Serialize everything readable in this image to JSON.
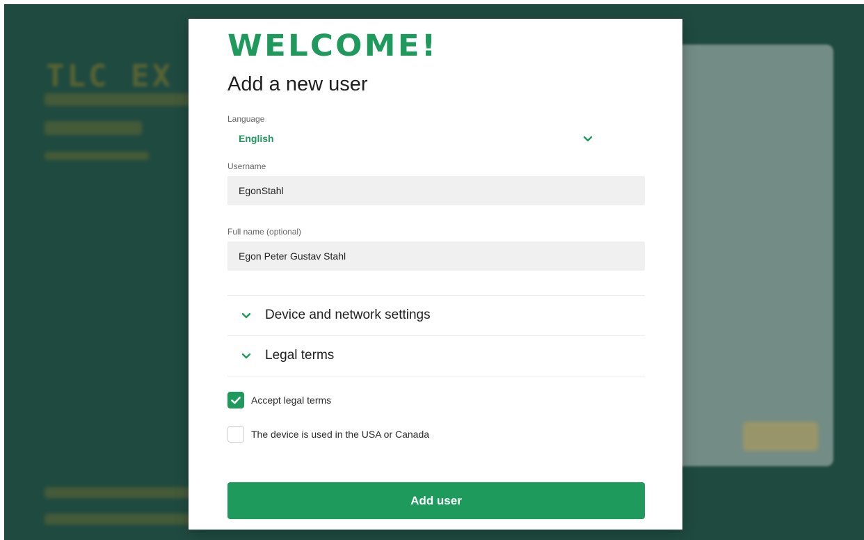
{
  "modal": {
    "logo_text": "WELCOME!",
    "heading": "Add a new user",
    "language": {
      "label": "Language",
      "value": "English",
      "icon": "chevron-down-icon"
    },
    "username": {
      "label": "Username",
      "value": "EgonStahl"
    },
    "full_name": {
      "label": "Full name (optional)",
      "value": "Egon Peter Gustav Stahl"
    },
    "sections": [
      {
        "label": "Device and network settings",
        "icon": "chevron-down-icon",
        "expanded": false
      },
      {
        "label": "Legal terms",
        "icon": "chevron-down-icon",
        "expanded": false
      }
    ],
    "checkboxes": [
      {
        "label": "Accept legal terms",
        "checked": true
      },
      {
        "label": "The device is used in the USA or Canada",
        "checked": false
      }
    ],
    "submit_label": "Add user"
  },
  "colors": {
    "accent": "#1d9a5c",
    "backdrop": "#1f4a40",
    "input_bg": "#f0f0f0"
  }
}
